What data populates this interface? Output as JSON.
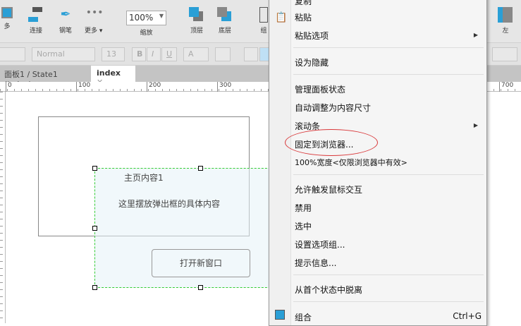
{
  "toolbar": {
    "partial_left": "多",
    "connect": "连接",
    "pen": "钢笔",
    "more": "更多 ▾",
    "zoom_value": "100%",
    "zoom_label": "缩放",
    "top": "顶层",
    "bottom": "底层",
    "group_partial": "组",
    "left": "左"
  },
  "format": {
    "style": "Normal",
    "size": "13",
    "bold": "B",
    "italic": "I",
    "underline": "U",
    "color": "A"
  },
  "tabs": [
    {
      "label": "面板1 / State1 (index)"
    },
    {
      "label": "index"
    }
  ],
  "ruler": [
    "0",
    "100",
    "200",
    "300",
    "700"
  ],
  "canvas": {
    "title": "主页内容1",
    "body": "这里摆放弹出框的具体内容",
    "button": "打开新窗口"
  },
  "menu": {
    "items": [
      "复制",
      "粘贴",
      "粘贴选项",
      "设为隐藏",
      "管理面板状态",
      "自动调整为内容尺寸",
      "滚动条",
      "固定到浏览器...",
      "100%宽度<仅限浏览器中有效>",
      "允许触发鼠标交互",
      "禁用",
      "选中",
      "设置选项组...",
      "提示信息...",
      "从首个状态中脱离",
      "组合"
    ],
    "shortcut_group": "Ctrl+G"
  },
  "colors": {
    "accent": "#2a9fd6",
    "highlight": "#d9383a",
    "selection": "#33cc33"
  }
}
